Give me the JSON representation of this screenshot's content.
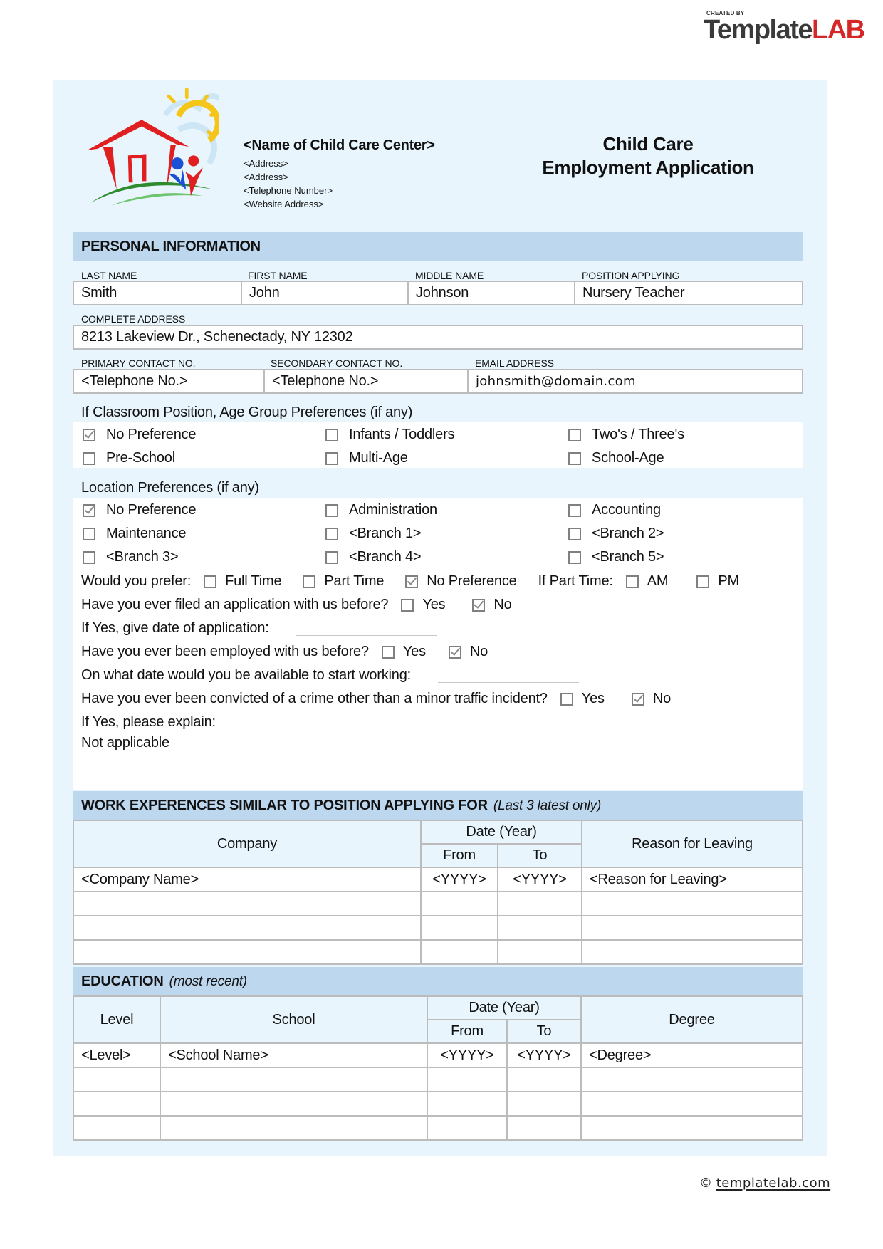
{
  "brand": {
    "created_by": "CREATED BY",
    "template": "Template",
    "lab": "LAB"
  },
  "header": {
    "center_name": "<Name of Child Care Center>",
    "address_1": "<Address>",
    "address_2": "<Address>",
    "telephone": "<Telephone Number>",
    "website": "<Website Address>",
    "title_line1": "Child Care",
    "title_line2": "Employment Application"
  },
  "personal": {
    "section_title": "PERSONAL INFORMATION",
    "labels": {
      "last_name": "LAST NAME",
      "first_name": "FIRST NAME",
      "middle_name": "MIDDLE NAME",
      "position": "POSITION APPLYING",
      "address": "COMPLETE ADDRESS",
      "primary": "PRIMARY CONTACT NO.",
      "secondary": "SECONDARY CONTACT NO.",
      "email": "EMAIL ADDRESS"
    },
    "values": {
      "last_name": "Smith",
      "first_name": "John",
      "middle_name": "Johnson",
      "position": "Nursery Teacher",
      "address": "8213 Lakeview Dr., Schenectady, NY 12302",
      "primary": "<Telephone No.>",
      "secondary": "<Telephone No.>",
      "email": "johnsmith@domain.com"
    }
  },
  "age_group": {
    "label": "If Classroom Position, Age Group Preferences (if any)",
    "options": [
      {
        "label": "No Preference",
        "checked": true
      },
      {
        "label": "Infants / Toddlers",
        "checked": false
      },
      {
        "label": "Two's / Three's",
        "checked": false
      },
      {
        "label": "Pre-School",
        "checked": false
      },
      {
        "label": "Multi-Age",
        "checked": false
      },
      {
        "label": "School-Age",
        "checked": false
      }
    ]
  },
  "location": {
    "label": "Location Preferences (if any)",
    "options": [
      {
        "label": "No Preference",
        "checked": true
      },
      {
        "label": "Administration",
        "checked": false
      },
      {
        "label": "Accounting",
        "checked": false
      },
      {
        "label": "Maintenance",
        "checked": false
      },
      {
        "label": "<Branch 1>",
        "checked": false
      },
      {
        "label": "<Branch 2>",
        "checked": false
      },
      {
        "label": "<Branch 3>",
        "checked": false
      },
      {
        "label": "<Branch 4>",
        "checked": false
      },
      {
        "label": "<Branch 5>",
        "checked": false
      }
    ]
  },
  "questions": {
    "prefer": {
      "label": "Would you prefer:",
      "full_time": {
        "label": "Full Time",
        "checked": false
      },
      "part_time": {
        "label": "Part Time",
        "checked": false
      },
      "no_pref": {
        "label": "No Preference",
        "checked": true
      },
      "if_part_label": "If Part Time:",
      "am": {
        "label": "AM",
        "checked": false
      },
      "pm": {
        "label": "PM",
        "checked": false
      }
    },
    "filed_before": {
      "label": "Have you ever filed an application with us before?",
      "yes": {
        "label": "Yes",
        "checked": false
      },
      "no": {
        "label": "No",
        "checked": true
      }
    },
    "date_of_application": {
      "label": "If Yes, give date of application:",
      "value": ""
    },
    "employed_before": {
      "label": "Have you ever been employed with us before?",
      "yes": {
        "label": "Yes",
        "checked": false
      },
      "no": {
        "label": "No",
        "checked": true
      }
    },
    "start_date": {
      "label": "On what date would you be available to start working:",
      "value": ""
    },
    "convicted": {
      "label": "Have you ever been convicted of a crime other than a minor traffic incident?",
      "yes": {
        "label": "Yes",
        "checked": false
      },
      "no": {
        "label": "No",
        "checked": true
      }
    },
    "explain": {
      "label": "If Yes, please explain:",
      "value": "Not applicable"
    }
  },
  "work": {
    "section_title": "WORK EXPERENCES SIMILAR TO POSITION APPLYING FOR",
    "section_sub": "(Last 3 latest only)",
    "headers": {
      "company": "Company",
      "date": "Date (Year)",
      "from": "From",
      "to": "To",
      "reason": "Reason for Leaving"
    },
    "rows": [
      {
        "company": "<Company Name>",
        "from": "<YYYY>",
        "to": "<YYYY>",
        "reason": "<Reason for Leaving>"
      },
      {
        "company": "",
        "from": "",
        "to": "",
        "reason": ""
      },
      {
        "company": "",
        "from": "",
        "to": "",
        "reason": ""
      },
      {
        "company": "",
        "from": "",
        "to": "",
        "reason": ""
      }
    ]
  },
  "education": {
    "section_title": "EDUCATION",
    "section_sub": "(most recent)",
    "headers": {
      "level": "Level",
      "school": "School",
      "date": "Date (Year)",
      "from": "From",
      "to": "To",
      "degree": "Degree"
    },
    "rows": [
      {
        "level": "<Level>",
        "school": "<School Name>",
        "from": "<YYYY>",
        "to": "<YYYY>",
        "degree": "<Degree>"
      },
      {
        "level": "",
        "school": "",
        "from": "",
        "to": "",
        "degree": ""
      },
      {
        "level": "",
        "school": "",
        "from": "",
        "to": "",
        "degree": ""
      },
      {
        "level": "",
        "school": "",
        "from": "",
        "to": "",
        "degree": ""
      }
    ]
  },
  "footer": {
    "copyright": "©",
    "link": "templatelab.com"
  }
}
